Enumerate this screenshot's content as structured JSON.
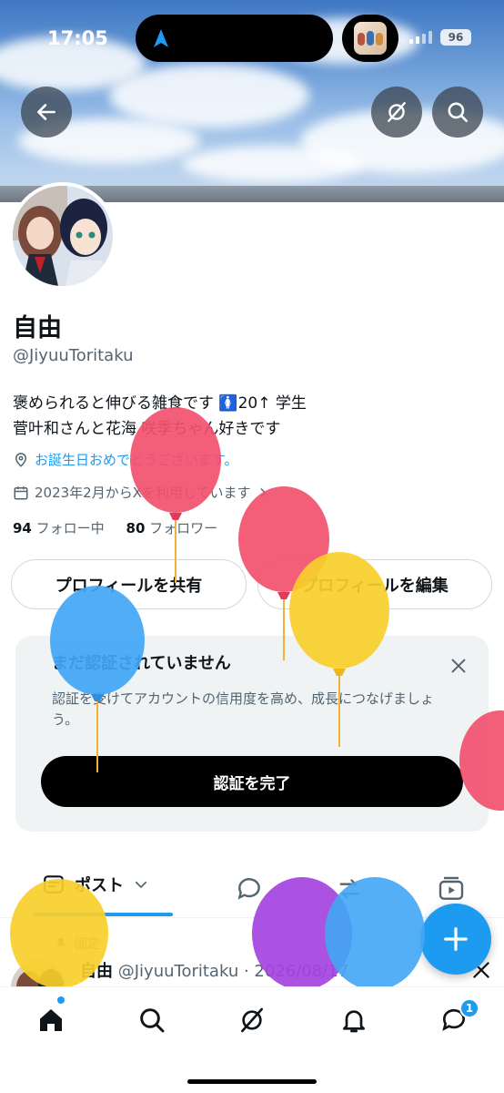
{
  "status_bar": {
    "time": "17:05",
    "battery": "96"
  },
  "profile": {
    "display_name": "自由",
    "handle": "@JiyuuToritaku",
    "bio_line1": "褒められると伸びる雑食です 🚺20↑ 学生",
    "bio_line2": "菅叶和さんと花海 咲季ちゃん好きです",
    "birthday": "お誕生日おめでとうございます。",
    "joined": "2023年2月からXを利用しています",
    "following_count": "94",
    "following_label": "フォロー中",
    "followers_count": "80",
    "followers_label": "フォロワー"
  },
  "buttons": {
    "share": "プロフィールを共有",
    "edit": "プロフィールを編集"
  },
  "verify_card": {
    "title": "まだ認証されていません",
    "description": "認証を受けてアカウントの信用度を高め、成長につなげましょう。",
    "action": "認証を完了"
  },
  "tabs": {
    "active": "ポスト"
  },
  "pinned_post": {
    "pinned_label": "固定",
    "author": "自由",
    "handle_date": "@JiyuuToritaku · 2026/08/17"
  },
  "bottom_nav": {
    "messages_badge": "1"
  },
  "colors": {
    "accent": "#1d9bf0",
    "text": "#0f1419",
    "muted": "#536471"
  },
  "icons": [
    "back-arrow-icon",
    "grok-icon",
    "search-icon",
    "location-icon",
    "calendar-icon",
    "chevron-right-icon",
    "close-icon",
    "chevron-down-icon",
    "reply-icon",
    "repost-icon",
    "video-icon",
    "pin-icon",
    "plus-icon",
    "home-icon",
    "bell-icon",
    "messages-icon",
    "x-logo-icon",
    "balloon-icon"
  ]
}
